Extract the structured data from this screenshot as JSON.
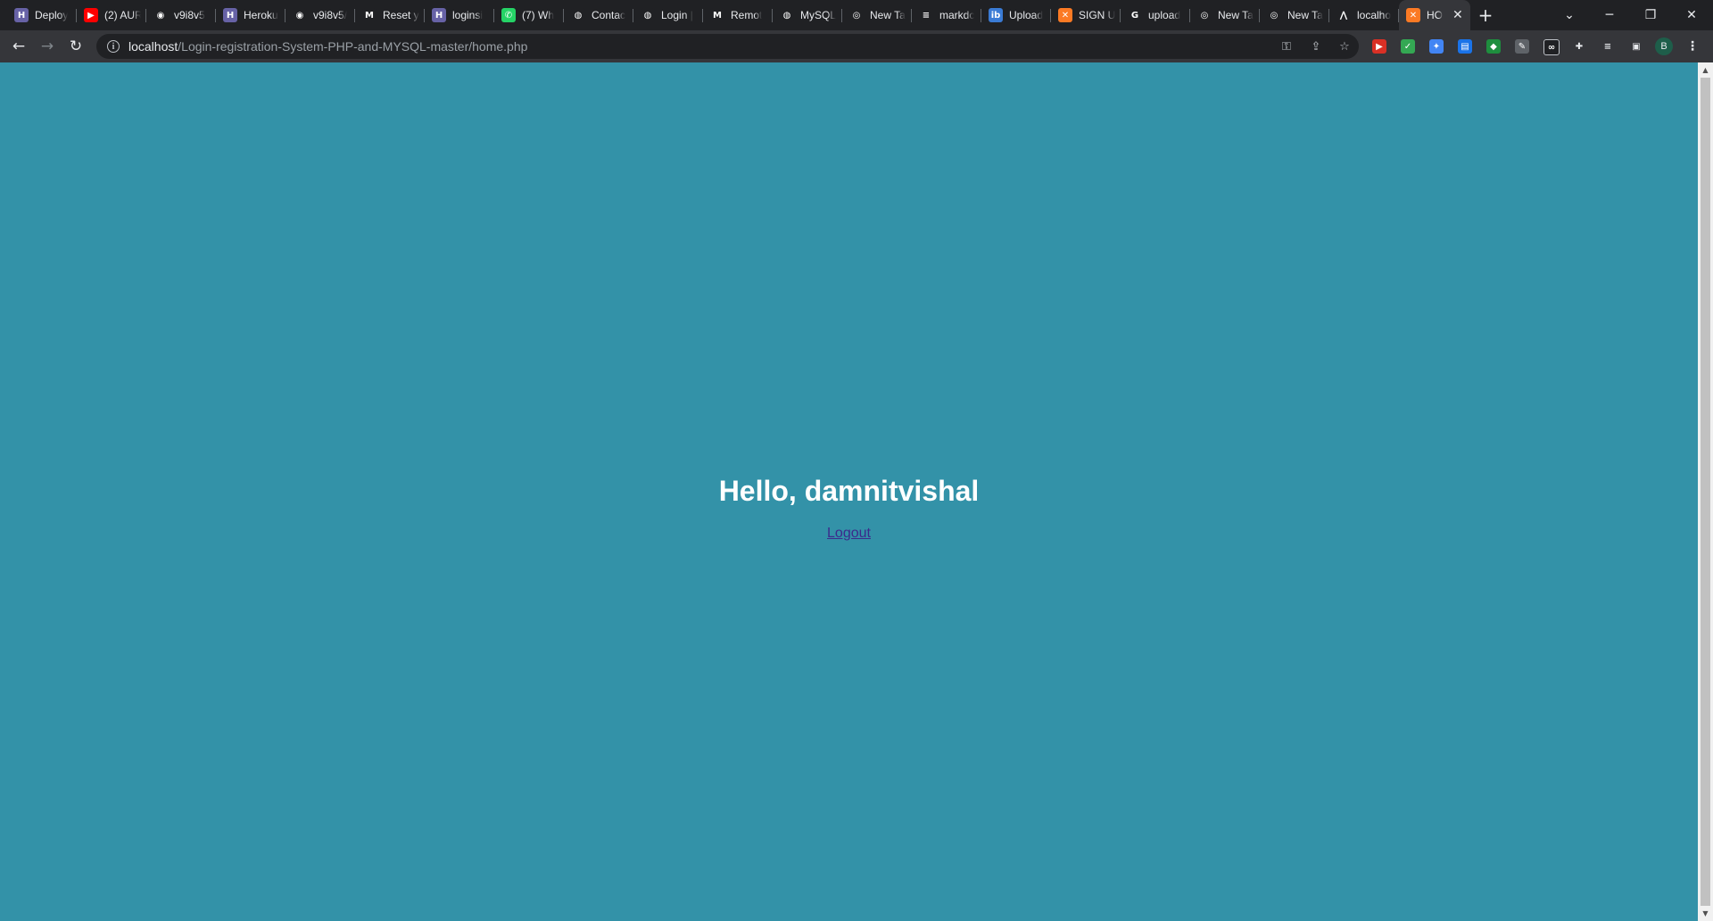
{
  "browser": {
    "tabs": [
      {
        "title": "Deploy",
        "icon": "heroku-icon",
        "color": "#6762a6",
        "glyph": "H"
      },
      {
        "title": "(2) AUR",
        "icon": "youtube-icon",
        "color": "#ff0000",
        "glyph": "▶"
      },
      {
        "title": "v9i8v5",
        "icon": "github-icon",
        "color": "#202124",
        "glyph": "◉"
      },
      {
        "title": "Heroku",
        "icon": "heroku-icon",
        "color": "#6762a6",
        "glyph": "H"
      },
      {
        "title": "v9i8v5/",
        "icon": "github-icon",
        "color": "#202124",
        "glyph": "◉"
      },
      {
        "title": "Reset y",
        "icon": "gmail-icon",
        "color": "#202124",
        "glyph": "M"
      },
      {
        "title": "loginsi",
        "icon": "heroku-icon",
        "color": "#6762a6",
        "glyph": "H"
      },
      {
        "title": "(7) Wh",
        "icon": "whatsapp-icon",
        "color": "#25d366",
        "glyph": "✆"
      },
      {
        "title": "Contac",
        "icon": "globe-icon",
        "color": "#202124",
        "glyph": "◍"
      },
      {
        "title": "Login |",
        "icon": "globe-icon",
        "color": "#202124",
        "glyph": "◍"
      },
      {
        "title": "Remot",
        "icon": "gmail-icon",
        "color": "#202124",
        "glyph": "M"
      },
      {
        "title": "MySQL",
        "icon": "globe-icon",
        "color": "#202124",
        "glyph": "◍"
      },
      {
        "title": "New Ta",
        "icon": "chrome-icon",
        "color": "#202124",
        "glyph": "◎"
      },
      {
        "title": "markdc",
        "icon": "stackoverflow-icon",
        "color": "#202124",
        "glyph": "≡"
      },
      {
        "title": "Upload",
        "icon": "imgbb-icon",
        "color": "#3a7bd5",
        "glyph": "ib"
      },
      {
        "title": "SIGN U",
        "icon": "xampp-icon",
        "color": "#fb7a24",
        "glyph": "✕"
      },
      {
        "title": "upload",
        "icon": "google-icon",
        "color": "#202124",
        "glyph": "G"
      },
      {
        "title": "New Ta",
        "icon": "chrome-icon",
        "color": "#202124",
        "glyph": "◎"
      },
      {
        "title": "New Ta",
        "icon": "chrome-icon",
        "color": "#202124",
        "glyph": "◎"
      },
      {
        "title": "localho",
        "icon": "phpmyadmin-icon",
        "color": "#202124",
        "glyph": "⋀"
      }
    ],
    "active_tab": {
      "title": "HO",
      "icon": "xampp-icon",
      "color": "#fb7a24",
      "glyph": "✕"
    },
    "url_host": "localhost",
    "url_path": "/Login-registration-System-PHP-and-MYSQL-master/home.php",
    "profile_initial": "B"
  },
  "page": {
    "background": "#3392a8",
    "greeting": "Hello, damnitvishal",
    "logout_label": "Logout"
  }
}
